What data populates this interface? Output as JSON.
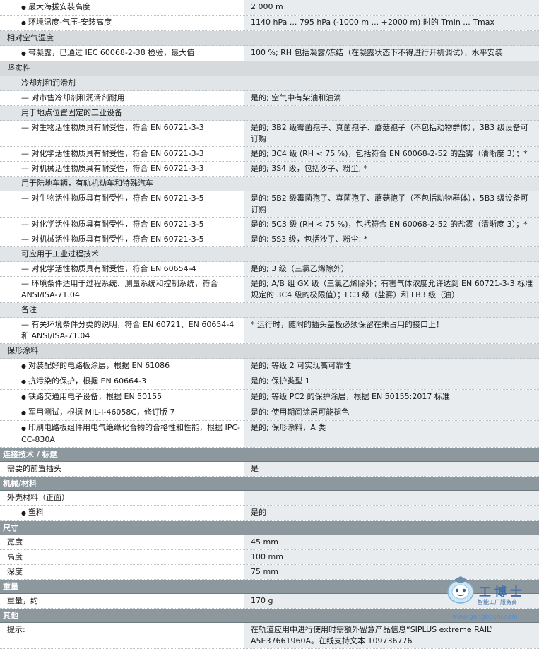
{
  "rows": [
    {
      "type": "bullet",
      "label": "最大海拔安装高度",
      "value": "2 000 m"
    },
    {
      "type": "bullet",
      "label": "环境温度-气压-安装高度",
      "value": "1140 hPa ... 795 hPa (-1000 m ... +2000 m) 时的 Tmin ... Tmax"
    },
    {
      "type": "sub",
      "label": "相对空气湿度"
    },
    {
      "type": "bullet",
      "label": "带凝露，已通过 IEC 60068-2-38 检验，最大值",
      "value": "100 %; RH 包括凝露/冻结（在凝露状态下不得进行开机调试），水平安装"
    },
    {
      "type": "sub",
      "label": "坚实性"
    },
    {
      "type": "sub2",
      "label": "冷却剂和润滑剂"
    },
    {
      "type": "dash",
      "label": "— 对市售冷却剂和润滑剂耐用",
      "value": "是的; 空气中有柴油和油滴"
    },
    {
      "type": "sub2",
      "label": "用于地点位置固定的工业设备"
    },
    {
      "type": "dash",
      "label": "— 对生物活性物质具有耐受性，符合 EN 60721-3-3",
      "value": "是的; 3B2 级霉菌孢子、真菌孢子、蘑菇孢子（不包括动物群体），3B3 级设备可订购"
    },
    {
      "type": "dash",
      "label": "— 对化学活性物质具有耐受性，符合 EN 60721-3-3",
      "value": "是的; 3C4 级 (RH < 75 %)，包括符合 EN 60068-2-52 的盐雾（清晰度 3）；*"
    },
    {
      "type": "dash",
      "label": "— 对机械活性物质具有耐受性，符合 EN 60721-3-3",
      "value": "是的; 3S4 级，包括沙子、粉尘; *"
    },
    {
      "type": "sub2",
      "label": "用于陆地车辆，有轨机动车和特殊汽车"
    },
    {
      "type": "dash",
      "label": "— 对生物活性物质具有耐受性，符合 EN 60721-3-5",
      "value": "是的; 5B2 级霉菌孢子、真菌孢子、蘑菇孢子（不包括动物群体），5B3 级设备可订购"
    },
    {
      "type": "dash",
      "label": "— 对化学活性物质具有耐受性，符合 EN 60721-3-5",
      "value": "是的; 5C3 级 (RH < 75 %)，包括符合 EN 60068-2-52 的盐雾（清晰度 3）；*"
    },
    {
      "type": "dash",
      "label": "— 对机械活性物质具有耐受性，符合 EN 60721-3-5",
      "value": "是的; 5S3 级，包括沙子、粉尘; *"
    },
    {
      "type": "sub2",
      "label": "可应用于工业过程技术"
    },
    {
      "type": "dash",
      "label": "— 对化学活性物质具有耐受性，符合 EN 60654-4",
      "value": "是的; 3 级（三氯乙烯除外）"
    },
    {
      "type": "dash",
      "label": "— 环境条件适用于过程系统、测量系统和控制系统，符合 ANSI/ISA-71.04",
      "value": "是的; A/B 组 GX 级（三氯乙烯除外；有害气体浓度允许达到 EN 60721-3-3 标准规定的 3C4 级的极限值）；LC3 级（盐雾）和 LB3 级（油）"
    },
    {
      "type": "sub2",
      "label": "备注"
    },
    {
      "type": "dash",
      "label": "— 有关环境条件分类的说明，符合 EN 60721、EN 60654-4 和 ANSI/ISA-71.04",
      "value": "* 运行时，随附的插头盖板必须保留在未占用的接口上！"
    },
    {
      "type": "sub",
      "label": "保形涂料"
    },
    {
      "type": "bullet",
      "label": "对装配好的电路板涂层，根据 EN 61086",
      "value": "是的; 等级 2 可实现高可靠性"
    },
    {
      "type": "bullet",
      "label": "抗污染的保护，根据 EN 60664-3",
      "value": "是的; 保护类型 1"
    },
    {
      "type": "bullet",
      "label": "铁路交通用电子设备，根据 EN 50155",
      "value": "是的; 等级 PC2 的保护涂层，根据 EN 50155:2017 标准"
    },
    {
      "type": "bullet",
      "label": "军用测试，根据 MIL-I-46058C，修订版 7",
      "value": "是的; 使用期间涂层可能褪色"
    },
    {
      "type": "bullet",
      "label": "印刷电路板组件用电气绝缘化合物的合格性和性能，根据 IPC-CC-830A",
      "value": "是的; 保形涂料，A 类"
    },
    {
      "type": "head",
      "label": "连接技术 / 标题"
    },
    {
      "type": "plain",
      "label": "需要的前置插头",
      "value": "是"
    },
    {
      "type": "head",
      "label": "机械/材料"
    },
    {
      "type": "plain",
      "label": "外壳材料（正面）",
      "value": ""
    },
    {
      "type": "bullet",
      "label": "塑料",
      "value": "是的"
    },
    {
      "type": "head",
      "label": "尺寸"
    },
    {
      "type": "plain",
      "label": "宽度",
      "value": "45 mm"
    },
    {
      "type": "plain",
      "label": "高度",
      "value": "100 mm"
    },
    {
      "type": "plain",
      "label": "深度",
      "value": "75 mm"
    },
    {
      "type": "head",
      "label": "重量"
    },
    {
      "type": "plain",
      "label": "重量，约",
      "value": "170 g"
    },
    {
      "type": "head",
      "label": "其他"
    },
    {
      "type": "plain",
      "label": "提示:",
      "value": "在轨道应用中进行使用时需额外留意产品信息“SIPLUS extreme RAIL” A5E37661960A。在线支持文本 109736776"
    }
  ],
  "watermark": {
    "title": "工博士",
    "subtitle": "智能工厂服务商",
    "url": "www.gongboshi.com",
    "icon": "robot-mascot-icon"
  },
  "colors": {
    "section_header_bg": "#8c979e",
    "value_bg": "#e9ecee",
    "group_bg": "#d6dadd",
    "watermark_blue": "#3f6fa8"
  }
}
